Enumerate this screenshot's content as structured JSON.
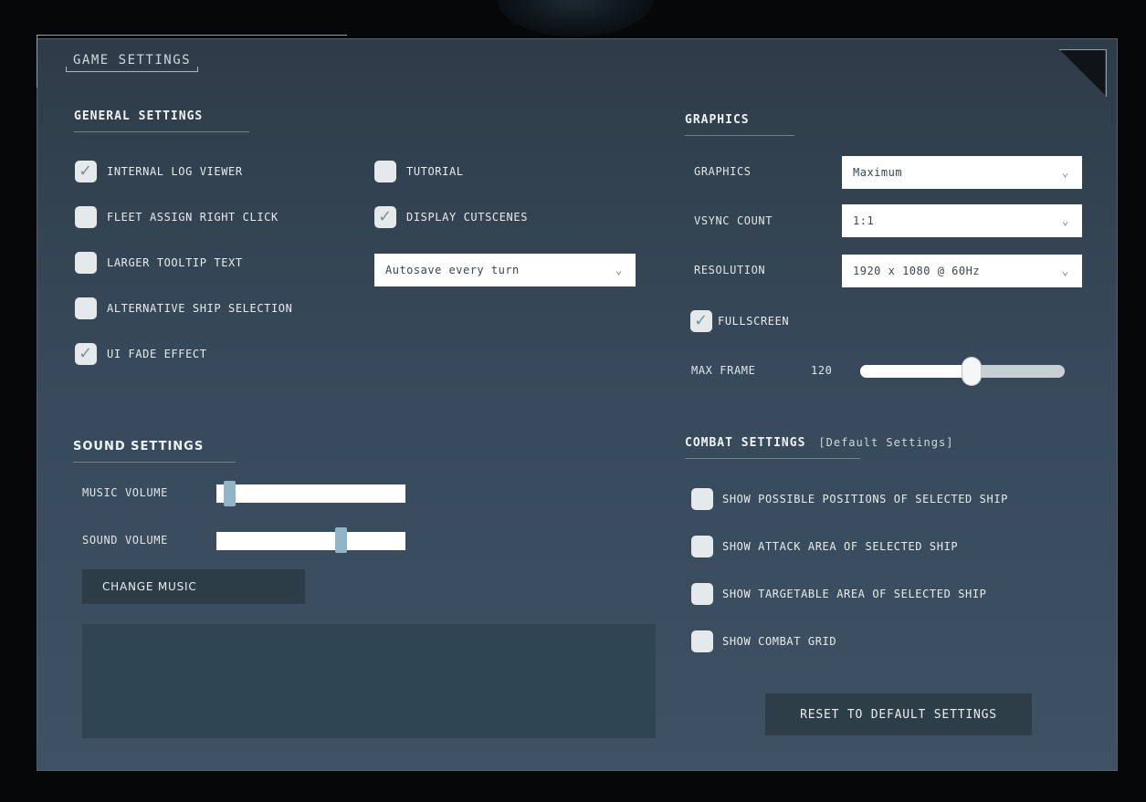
{
  "window": {
    "title": "GAME SETTINGS"
  },
  "general": {
    "heading": "GENERAL SETTINGS",
    "left_options": [
      {
        "label": "INTERNAL LOG VIEWER",
        "checked": true
      },
      {
        "label": "FLEET ASSIGN RIGHT CLICK",
        "checked": false
      },
      {
        "label": "LARGER TOOLTIP TEXT",
        "checked": false
      },
      {
        "label": "ALTERNATIVE SHIP SELECTION",
        "checked": false
      },
      {
        "label": "UI FADE EFFECT",
        "checked": true
      }
    ],
    "right_options": [
      {
        "label": "TUTORIAL",
        "checked": false
      },
      {
        "label": "DISPLAY CUTSCENES",
        "checked": true
      }
    ],
    "autosave": {
      "selected": "Autosave every turn"
    }
  },
  "sound": {
    "heading": "SOUND SETTINGS",
    "music_label": "MUSIC VOLUME",
    "music_level": 0.04,
    "sound_label": "SOUND VOLUME",
    "sound_level": 0.67,
    "change_music_label": "CHANGE MUSIC"
  },
  "graphics": {
    "heading": "GRAPHICS",
    "graphics_label": "GRAPHICS",
    "graphics_value": "Maximum",
    "vsync_label": "VSYNC COUNT",
    "vsync_value": "1:1",
    "resolution_label": "RESOLUTION",
    "resolution_value": "1920 x 1080 @ 60Hz",
    "fullscreen_label": "FULLSCREEN",
    "fullscreen_checked": true,
    "max_frame_label": "MAX FRAME",
    "max_frame_value": "120",
    "max_frame_level": 0.55
  },
  "combat": {
    "heading": "COMBAT SETTINGS",
    "subheading": "[Default Settings]",
    "options": [
      {
        "label": "SHOW POSSIBLE POSITIONS OF SELECTED SHIP",
        "checked": false
      },
      {
        "label": "SHOW ATTACK AREA OF SELECTED SHIP",
        "checked": false
      },
      {
        "label": "SHOW TARGETABLE AREA OF SELECTED SHIP",
        "checked": false
      },
      {
        "label": "SHOW COMBAT GRID",
        "checked": false
      }
    ],
    "reset_label": "RESET TO DEFAULT SETTINGS"
  },
  "icons": {
    "check": "checkmark-icon",
    "dropdown": "chevron-down-icon",
    "corner": "close-corner-icon"
  },
  "colors": {
    "panel": "#37495a",
    "accent_knob": "#8fb5c6",
    "button": "#2d3e49"
  }
}
